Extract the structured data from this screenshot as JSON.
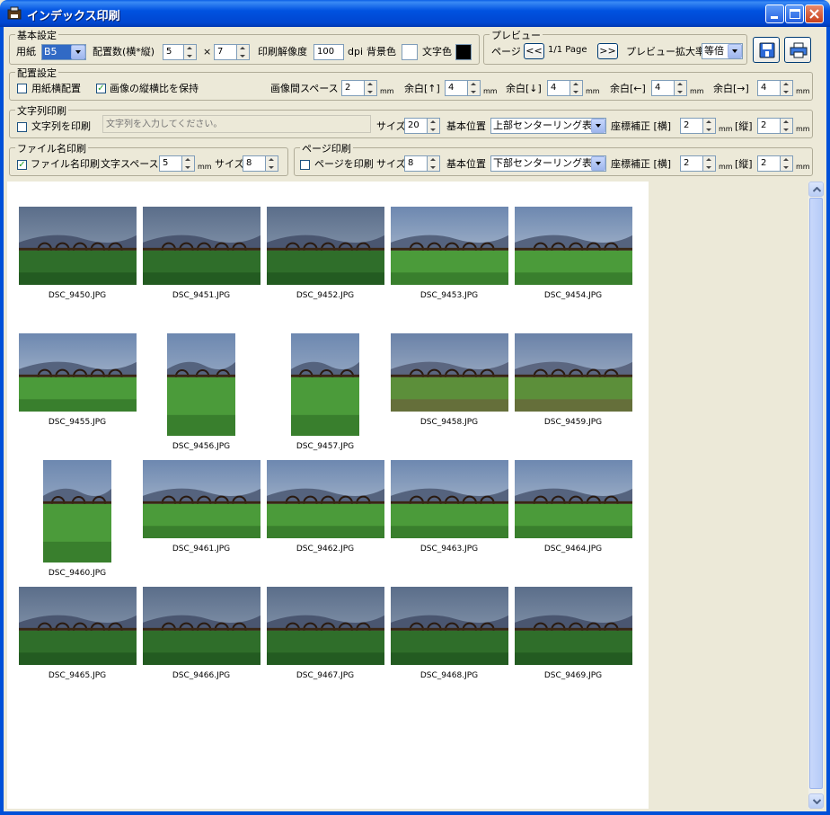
{
  "window": {
    "title": "インデックス印刷"
  },
  "basic": {
    "group_label": "基本設定",
    "paper_label": "用紙",
    "paper_value": "B5",
    "layout_label": "配置数(横*縦)",
    "cols": "5",
    "times": "×",
    "rows": "7",
    "dpi_label": "印刷解像度",
    "dpi": "100",
    "dpi_unit": "dpi",
    "bg_label": "背景色",
    "fg_label": "文字色",
    "bg_color": "#ffffff",
    "fg_color": "#000000"
  },
  "preview_group": {
    "group_label": "プレビュー",
    "page_label": "ページ",
    "prev": "<<",
    "page_info": "1/1 Page",
    "next": ">>",
    "zoom_label": "プレビュー拡大率",
    "zoom_value": "等倍"
  },
  "layout": {
    "group_label": "配置設定",
    "landscape_label": "用紙横配置",
    "landscape_checked": false,
    "aspect_label": "画像の縦横比を保持",
    "aspect_checked": true,
    "space_label": "画像間スペース",
    "space": "2",
    "top_label": "余白[↑]",
    "top": "4",
    "bottom_label": "余白[↓]",
    "bottom": "4",
    "left_label": "余白[←]",
    "left": "4",
    "right_label": "余白[→]",
    "right": "4",
    "unit": "mm"
  },
  "text_print": {
    "group_label": "文字列印刷",
    "enable_label": "文字列を印刷",
    "enable_checked": false,
    "placeholder": "文字列を入力してください。",
    "size_label": "サイズ",
    "size": "20",
    "pos_label": "基本位置",
    "pos_value": "上部センターリング表示",
    "offset_label": "座標補正 [横]",
    "offset_x": "2",
    "offset_y_label": "[縦]",
    "offset_y": "2",
    "unit": "mm"
  },
  "file_print": {
    "group_label": "ファイル名印刷",
    "enable_label": "ファイル名印刷",
    "enable_checked": true,
    "space_label": "文字スペース",
    "space": "5",
    "unit": "mm",
    "size_label": "サイズ",
    "size": "8"
  },
  "page_print": {
    "group_label": "ページ印刷",
    "enable_label": "ページを印刷",
    "enable_checked": false,
    "size_label": "サイズ",
    "size": "8",
    "pos_label": "基本位置",
    "pos_value": "下部センターリング表示",
    "offset_label": "座標補正 [横]",
    "offset_x": "2",
    "offset_y_label": "[縦]",
    "offset_y": "2",
    "unit": "mm"
  },
  "thumbnails": [
    {
      "name": "DSC_9450.JPG",
      "orient": "landscape",
      "tone": "dusk"
    },
    {
      "name": "DSC_9451.JPG",
      "orient": "landscape",
      "tone": "dusk"
    },
    {
      "name": "DSC_9452.JPG",
      "orient": "landscape",
      "tone": "dusk"
    },
    {
      "name": "DSC_9453.JPG",
      "orient": "landscape",
      "tone": "day"
    },
    {
      "name": "DSC_9454.JPG",
      "orient": "landscape",
      "tone": "day"
    },
    {
      "name": "DSC_9455.JPG",
      "orient": "landscape",
      "tone": "day"
    },
    {
      "name": "DSC_9456.JPG",
      "orient": "portrait",
      "tone": "day"
    },
    {
      "name": "DSC_9457.JPG",
      "orient": "portrait",
      "tone": "day"
    },
    {
      "name": "DSC_9458.JPG",
      "orient": "landscape",
      "tone": "blur"
    },
    {
      "name": "DSC_9459.JPG",
      "orient": "landscape",
      "tone": "blur"
    },
    {
      "name": "DSC_9460.JPG",
      "orient": "portrait",
      "tone": "day"
    },
    {
      "name": "DSC_9461.JPG",
      "orient": "landscape",
      "tone": "day"
    },
    {
      "name": "DSC_9462.JPG",
      "orient": "landscape",
      "tone": "day"
    },
    {
      "name": "DSC_9463.JPG",
      "orient": "landscape",
      "tone": "day"
    },
    {
      "name": "DSC_9464.JPG",
      "orient": "landscape",
      "tone": "day"
    },
    {
      "name": "DSC_9465.JPG",
      "orient": "landscape",
      "tone": "dusk"
    },
    {
      "name": "DSC_9466.JPG",
      "orient": "landscape",
      "tone": "dusk"
    },
    {
      "name": "DSC_9467.JPG",
      "orient": "landscape",
      "tone": "dusk"
    },
    {
      "name": "DSC_9468.JPG",
      "orient": "landscape",
      "tone": "dusk"
    },
    {
      "name": "DSC_9469.JPG",
      "orient": "landscape",
      "tone": "dusk"
    }
  ]
}
